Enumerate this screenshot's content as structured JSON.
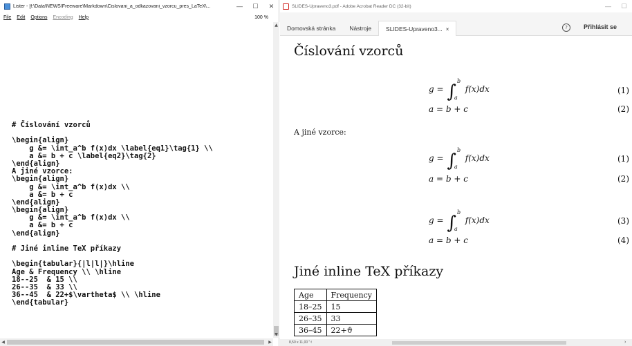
{
  "lister": {
    "title": "Lister - [f:\\Data\\NEWS\\Freeware\\Markdown\\Cislovani_a_odkazovani_vzorcu_pres_LaTeX\\...",
    "controls": {
      "minimize": "—",
      "maximize": "☐",
      "close": "✕"
    },
    "menu": {
      "file": "File",
      "edit": "Edit",
      "options": "Options",
      "encoding": "Encoding",
      "help": "Help"
    },
    "zoom": "100 %",
    "code_lines": [
      "# Číslování vzorců",
      "",
      "\\begin{align}",
      "    g &= \\int_a^b f(x)dx \\label{eq1}\\tag{1} \\\\",
      "    a &= b + c \\label{eq2}\\tag{2}",
      "\\end{align}",
      "A jiné vzorce:",
      "\\begin{align}",
      "    g &= \\int_a^b f(x)dx \\\\",
      "    a &= b + c",
      "\\end{align}",
      "\\begin{align}",
      "    g &= \\int_a^b f(x)dx \\\\",
      "    a &= b + c",
      "\\end{align}",
      "",
      "# Jiné inline TeX příkazy",
      "",
      "\\begin{tabular}{|l|l|}\\hline",
      "Age & Frequency \\\\ \\hline",
      "18--25  & 15 \\\\",
      "26--35  & 33 \\\\",
      "36--45  & 22+$\\vartheta$ \\\\ \\hline",
      "\\end{tabular}"
    ]
  },
  "acrobat": {
    "title": "SLIDES-Upraveno3.pdf - Adobe Acrobat Reader DC (32-bit)",
    "tabs": {
      "home": "Domovská stránka",
      "tools": "Nástroje",
      "doc": "SLIDES-Upraveno3...",
      "close": "×"
    },
    "help": "?",
    "login": "Přihlásit se",
    "status_size": "8,50 x 11,00 \"",
    "pdf": {
      "heading1": "Číslování vzorců",
      "heading2": "Jiné inline TeX příkazy",
      "text_other": "A jiné vzorce:",
      "eq_g": {
        "lhs": "g =",
        "upper": "b",
        "lower": "a",
        "body": "f(x)dx"
      },
      "eq_a": "a = b + c",
      "tags": [
        "(1)",
        "(2)",
        "(1)",
        "(2)",
        "(3)",
        "(4)"
      ],
      "table": {
        "headers": [
          "Age",
          "Frequency"
        ],
        "rows": [
          [
            "18–25",
            "15"
          ],
          [
            "26–35",
            "33"
          ],
          [
            "36–45",
            "22+ϑ"
          ]
        ]
      }
    }
  },
  "colors": {
    "acrobat_red": "#d0201c",
    "lister_icon": "#4a90d9"
  }
}
